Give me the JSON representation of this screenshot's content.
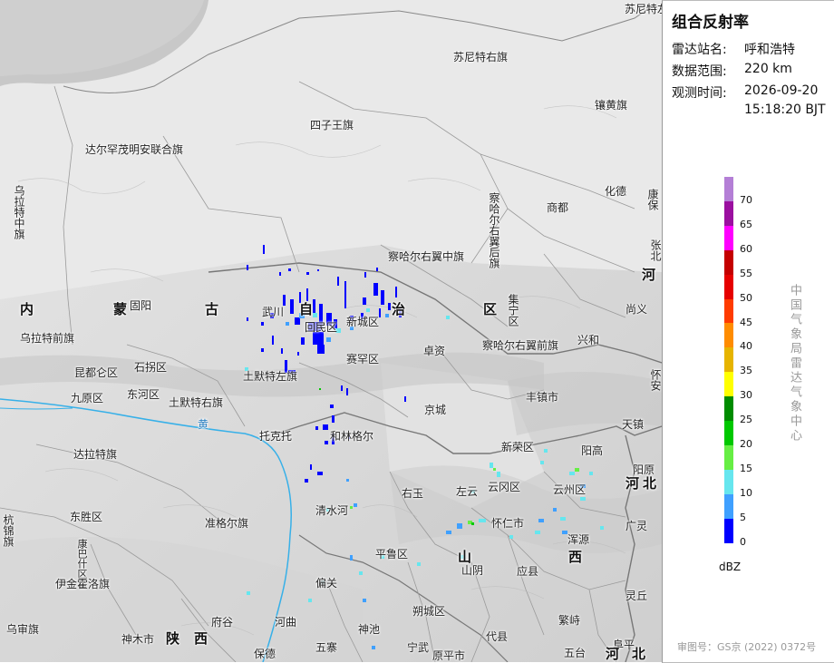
{
  "panel": {
    "title": "组合反射率",
    "station_label": "雷达站名:",
    "station_value": "呼和浩特",
    "range_label": "数据范围:",
    "range_value": "220 km",
    "time_label": "观测时间:",
    "time_value_date": "2026-09-20",
    "time_value_clock": "15:18:20 BJT",
    "unit": "dBZ",
    "organization": "中国气象局雷达气象中心",
    "approval": "审图号：GS京 (2022) 0372号"
  },
  "legend": [
    {
      "label": "70",
      "color": "#b47fd6"
    },
    {
      "label": "65",
      "color": "#9b0fa0"
    },
    {
      "label": "60",
      "color": "#ff00ff"
    },
    {
      "label": "55",
      "color": "#c40000"
    },
    {
      "label": "50",
      "color": "#e60000"
    },
    {
      "label": "45",
      "color": "#ff3b00"
    },
    {
      "label": "40",
      "color": "#ff8c00"
    },
    {
      "label": "35",
      "color": "#e6b400"
    },
    {
      "label": "30",
      "color": "#ffff00"
    },
    {
      "label": "25",
      "color": "#008c00"
    },
    {
      "label": "20",
      "color": "#00c800"
    },
    {
      "label": "15",
      "color": "#66ee44"
    },
    {
      "label": "10",
      "color": "#66e6ee"
    },
    {
      "label": "5",
      "color": "#3fa0ff"
    },
    {
      "label": "0",
      "color": "#0000ff"
    }
  ],
  "map_labels": {
    "l01": "苏尼特左旗",
    "l02": "苏尼特右旗",
    "l03": "镶黄旗",
    "l04": "四子王旗",
    "l05": "达尔罕茂明安联合旗",
    "l06": "乌拉特中旗",
    "l07": "察哈尔右翼后旗",
    "l08": "化德",
    "l09": "商都",
    "l10": "康保",
    "l11": "察哈尔右翼中旗",
    "l12": "张北",
    "l13": "尚义",
    "l14": "固阳",
    "l15": "武川",
    "l16": "内",
    "l17": "蒙",
    "l18": "古",
    "l19": "自",
    "l20": "治",
    "l21": "区",
    "l22": "乌拉特前旗",
    "l23": "回民区",
    "l24": "新城区",
    "l25": "集宁区",
    "l26": "兴和",
    "l27": "昆都仑区",
    "l28": "石拐区",
    "l29": "赛罕区",
    "l30": "卓资",
    "l31": "察哈尔右翼前旗",
    "l32": "九原区",
    "l33": "东河区",
    "l34": "土默特右旗",
    "l35": "土默特左旗",
    "l36": "丰镇市",
    "l37": "京城",
    "l38": "天镇",
    "l39": "怀安",
    "l40": "黄",
    "l41": "托克托",
    "l42": "和林格尔",
    "l43": "新荣区",
    "l44": "阳高",
    "l45": "阳原",
    "l46": "达拉特旗",
    "l47": "左云",
    "l48": "云冈区",
    "l49": "云州区",
    "l50": "右玉",
    "l51": "东胜区",
    "l52": "清水河",
    "l53": "怀仁市",
    "l54": "广灵",
    "l55": "准格尔旗",
    "l56": "浑源",
    "l57": "康巴什区",
    "l58": "杭锦旗",
    "l59": "平鲁区",
    "l60": "应县",
    "l61": "伊金霍洛旗",
    "l62": "偏关",
    "l63": "山阴",
    "l64": "灵丘",
    "l65": "朔城区",
    "l66": "繁峙",
    "l67": "乌审旗",
    "l68": "府谷",
    "l69": "河曲",
    "l70": "神池",
    "l71": "代县",
    "l72": "神木市",
    "l73": "陕",
    "l74": "西",
    "l75": "保德",
    "l76": "五寨",
    "l77": "宁武",
    "l78": "原平市",
    "l79": "五台",
    "l80": "阜平",
    "l81": "山",
    "l82": "西",
    "l83": "河",
    "l84": "北",
    "l85": "河",
    "l86": "北",
    "l87": "河"
  }
}
